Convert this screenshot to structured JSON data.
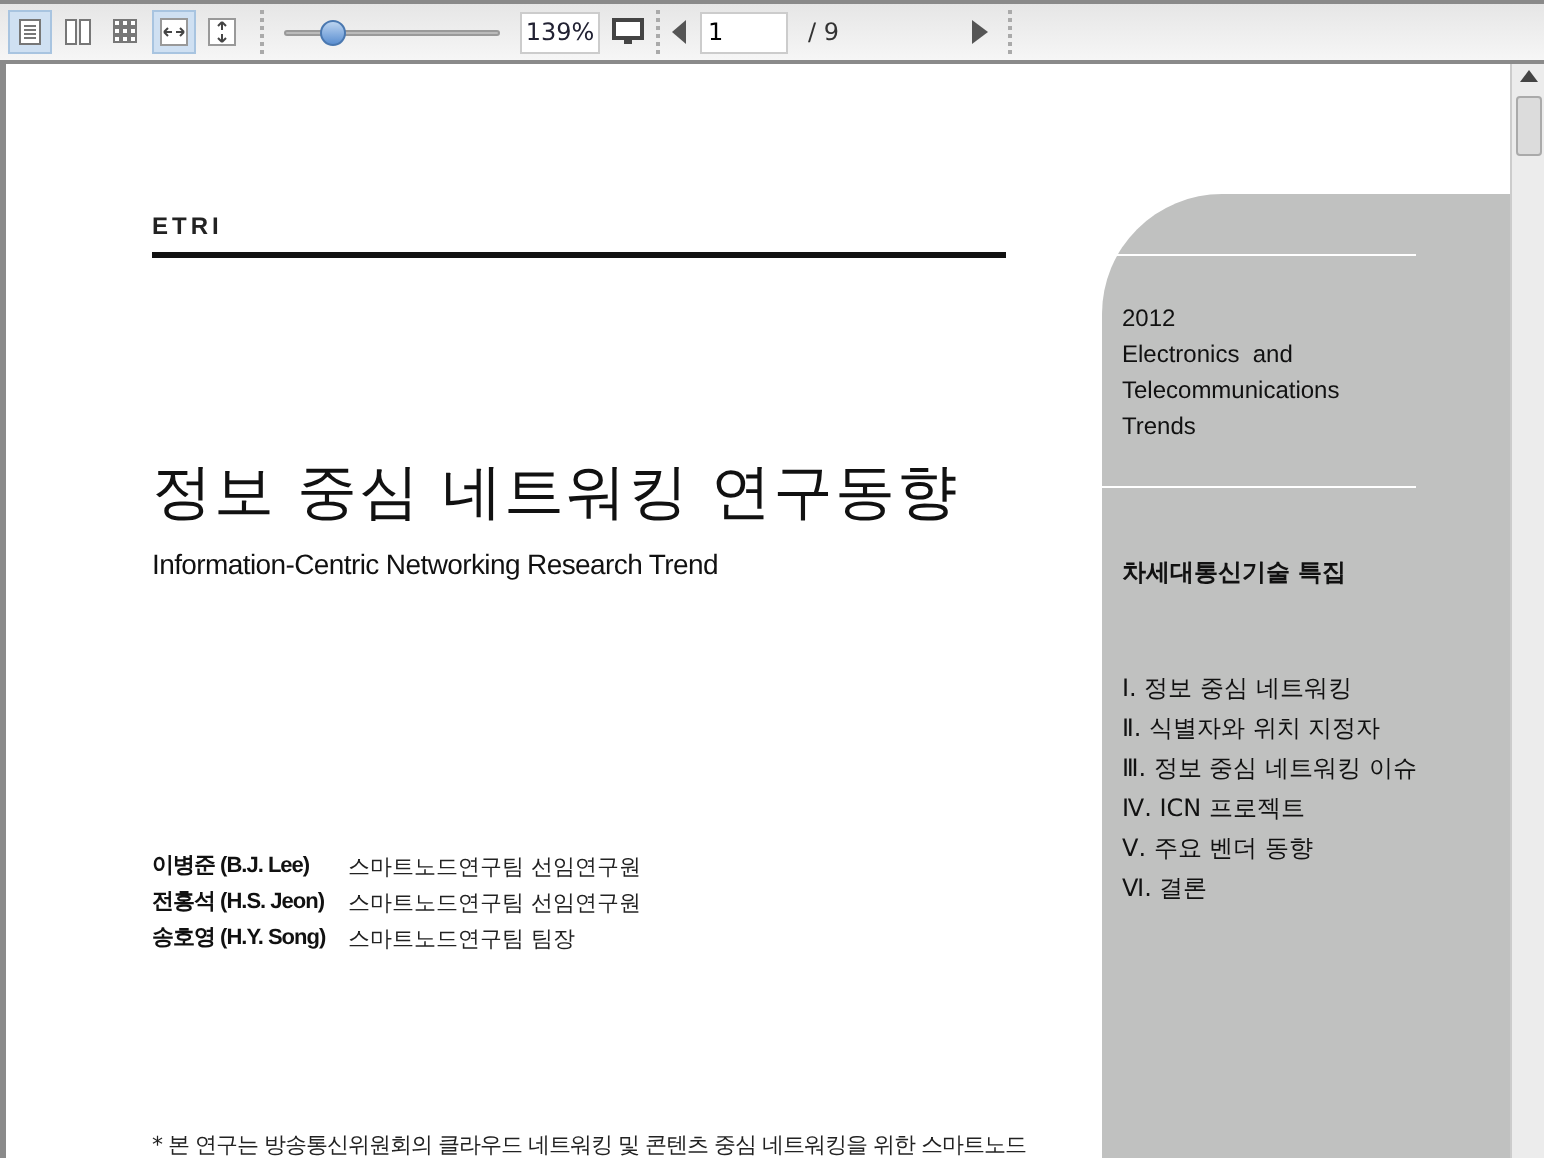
{
  "toolbar": {
    "view_buttons": [
      {
        "kind": "single",
        "selected": true
      },
      {
        "kind": "two",
        "selected": false
      },
      {
        "kind": "grid",
        "selected": false
      },
      {
        "kind": "fit_width",
        "selected": true
      },
      {
        "kind": "fit_height",
        "selected": false
      }
    ],
    "zoom": {
      "level": 0.22,
      "value": "139%"
    },
    "page": {
      "value": "1",
      "total": "/ 9"
    }
  },
  "document": {
    "logo": "ETRI",
    "title": "정보 중심 네트워킹 연구동향",
    "subtitle": "Information-Centric Networking Research Trend",
    "authors": [
      {
        "name": "이병준 (B.J. Lee)",
        "affiliation": "스마트노드연구팀 선임연구원"
      },
      {
        "name": "전홍석 (H.S. Jeon)",
        "affiliation": "스마트노드연구팀 선임연구원"
      },
      {
        "name": "송호영 (H.Y. Song)",
        "affiliation": "스마트노드연구팀 팀장"
      }
    ],
    "footnote": "* 본 연구는 방송통신위원회의 클라우드 네트워킹 및 콘텐츠 중심 네트워킹을 위한 스마트노드"
  },
  "sidebar": {
    "year": "2012",
    "journal_lines": [
      "Electronics  and",
      "Telecommunications",
      "Trends"
    ],
    "section": "차세대통신기술 특집",
    "contents": [
      "Ⅰ. 정보 중심 네트워킹",
      "Ⅱ. 식별자와 위치 지정자",
      "Ⅲ. 정보 중심 네트워킹 이슈",
      "Ⅳ. ICN 프로젝트",
      "Ⅴ. 주요 벤더 동향",
      "Ⅵ. 결론"
    ]
  }
}
